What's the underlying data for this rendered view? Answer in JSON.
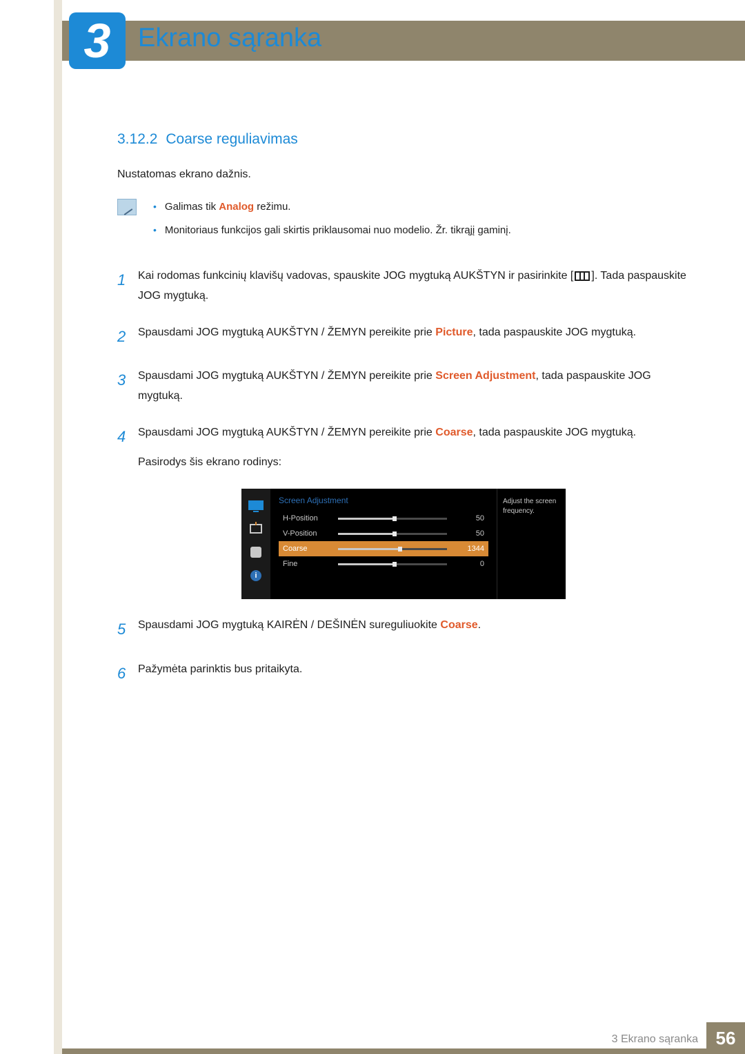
{
  "chapter": {
    "number": "3",
    "title": "Ekrano sąranka"
  },
  "section": {
    "number": "3.12.2",
    "title": "Coarse reguliavimas"
  },
  "intro": "Nustatomas ekrano dažnis.",
  "notes": {
    "n1_pre": "Galimas tik ",
    "n1_hl": "Analog",
    "n1_post": " režimu.",
    "n2": "Monitoriaus funkcijos gali skirtis priklausomai nuo modelio. Žr. tikrąjį gaminį."
  },
  "steps": {
    "s1a": "Kai rodomas funkcinių klavišų vadovas, spauskite JOG mygtuką AUKŠTYN ir pasirinkite [",
    "s1b": "]. Tada paspauskite JOG mygtuką.",
    "s2a": "Spausdami JOG mygtuką AUKŠTYN / ŽEMYN pereikite prie ",
    "s2hl": "Picture",
    "s2b": ", tada paspauskite JOG mygtuką.",
    "s3a": "Spausdami JOG mygtuką AUKŠTYN / ŽEMYN pereikite prie ",
    "s3hl": "Screen Adjustment",
    "s3b": ", tada paspauskite JOG mygtuką.",
    "s4a": "Spausdami JOG mygtuką AUKŠTYN / ŽEMYN pereikite prie ",
    "s4hl": "Coarse",
    "s4b": ", tada paspauskite JOG mygtuką.",
    "s4c": "Pasirodys šis ekrano rodinys:",
    "s5a": "Spausdami JOG mygtuką KAIRĖN / DEŠINĖN sureguliuokite ",
    "s5hl": "Coarse",
    "s5b": ".",
    "s6": "Pažymėta parinktis bus pritaikyta."
  },
  "nums": {
    "n1": "1",
    "n2": "2",
    "n3": "3",
    "n4": "4",
    "n5": "5",
    "n6": "6"
  },
  "osd": {
    "title": "Screen Adjustment",
    "rows": {
      "r1": {
        "label": "H-Position",
        "value": "50"
      },
      "r2": {
        "label": "V-Position",
        "value": "50"
      },
      "r3": {
        "label": "Coarse",
        "value": "1344"
      },
      "r4": {
        "label": "Fine",
        "value": "0"
      }
    },
    "help": "Adjust the screen frequency.",
    "info_glyph": "i"
  },
  "footer": {
    "text": "3 Ekrano sąranka",
    "page": "56"
  }
}
